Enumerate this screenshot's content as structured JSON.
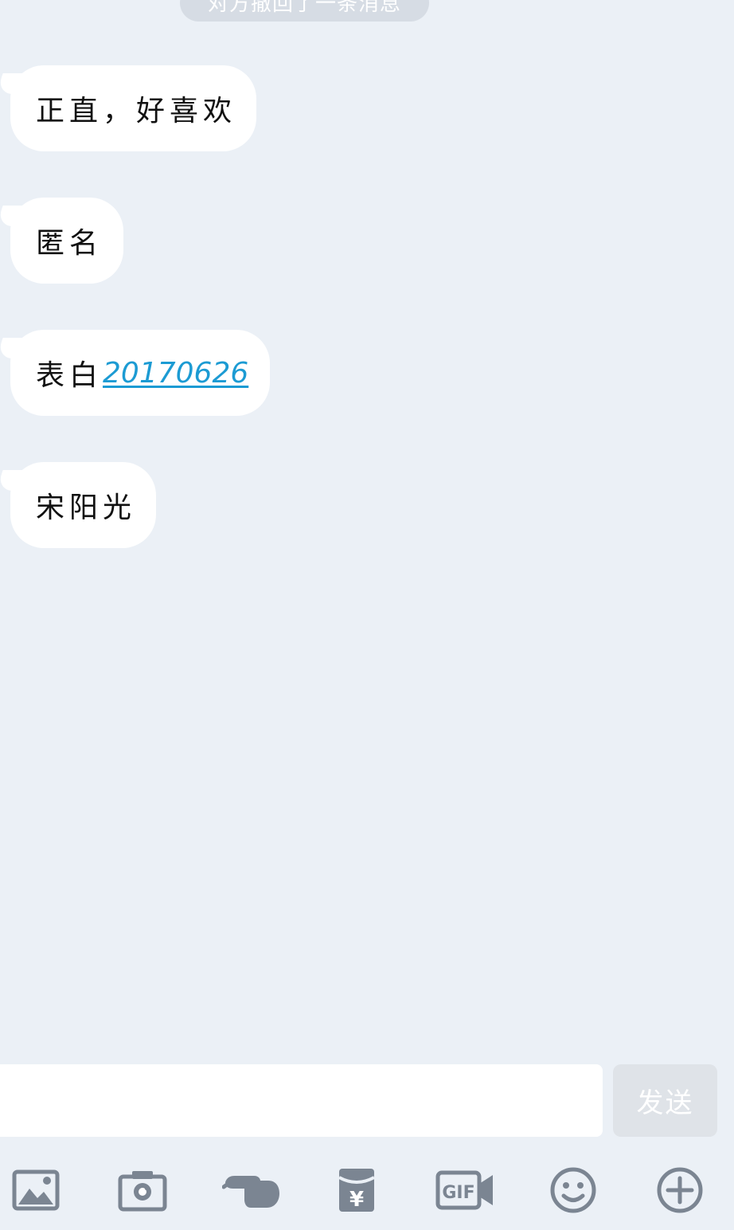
{
  "system_notice": "对方撤回了一条消息",
  "messages": [
    {
      "text": "正直，好喜欢"
    },
    {
      "text": "匿名"
    },
    {
      "text": "表白",
      "link": "20170626"
    },
    {
      "text": "宋阳光"
    }
  ],
  "composer": {
    "value": "",
    "placeholder": "",
    "send_label": "发送"
  },
  "toolbar": {
    "icons": [
      "image-icon",
      "camera-icon",
      "poke-icon",
      "red-packet-icon",
      "gif-icon",
      "emoji-icon",
      "plus-icon"
    ],
    "red_packet_symbol": "¥",
    "gif_text": "GIF"
  },
  "colors": {
    "background": "#ebf0f6",
    "bubble": "#ffffff",
    "link": "#1c9bd3",
    "icon": "#7b8592",
    "send_disabled": "#dfe3e8"
  }
}
